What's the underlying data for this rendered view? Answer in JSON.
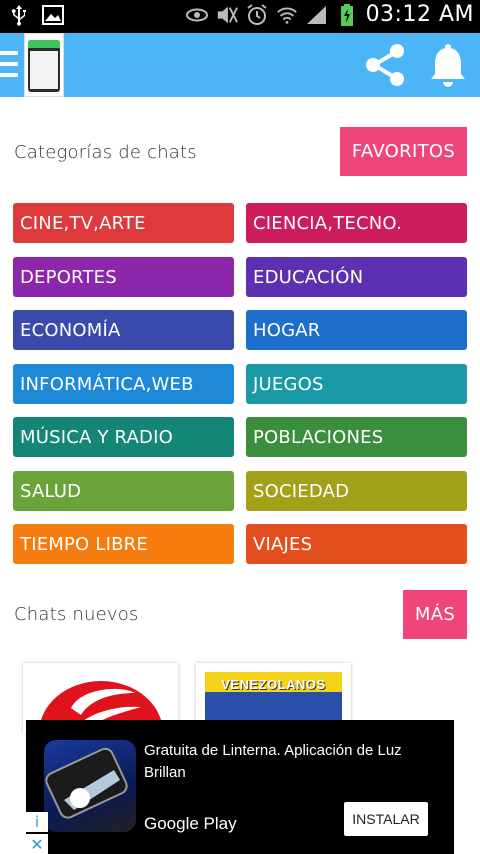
{
  "status_bar": {
    "time": "03:12 AM",
    "icons": [
      "usb-icon",
      "image-icon",
      "eye-icon",
      "mute-icon",
      "alarm-icon",
      "wifi-icon",
      "signal-icon",
      "battery-charging-icon"
    ]
  },
  "app_bar": {
    "background": "#4cb5f5",
    "icons": [
      "menu-icon",
      "app-logo",
      "share-icon",
      "notifications-bell-icon"
    ]
  },
  "categories_section": {
    "title": "Categorías de chats",
    "favorites_label": "FAVORITOS",
    "items": [
      {
        "label": "CINE,TV,ARTE",
        "color": "#de3a3c"
      },
      {
        "label": "CIENCIA,TECNO.",
        "color": "#cc1c5c"
      },
      {
        "label": "DEPORTES",
        "color": "#8c27ab"
      },
      {
        "label": "EDUCACIÓN",
        "color": "#5c30b0"
      },
      {
        "label": "ECONOMÍA",
        "color": "#3a4aaa"
      },
      {
        "label": "HOGAR",
        "color": "#1e6ecc"
      },
      {
        "label": "INFORMÁTICA,WEB",
        "color": "#1d89d8"
      },
      {
        "label": "JUEGOS",
        "color": "#1a9aa6"
      },
      {
        "label": "MÚSICA Y RADIO",
        "color": "#138677"
      },
      {
        "label": "POBLACIONES",
        "color": "#3a8e3e"
      },
      {
        "label": "SALUD",
        "color": "#6aa33a"
      },
      {
        "label": "SOCIEDAD",
        "color": "#a3a11a"
      },
      {
        "label": "TIEMPO LIBRE",
        "color": "#f77c10"
      },
      {
        "label": "VIAJES",
        "color": "#e34e1e"
      }
    ]
  },
  "new_chats_section": {
    "title": "Chats nuevos",
    "more_label": "MÁS",
    "cards": [
      {
        "name": "peru-chat-card"
      },
      {
        "name": "venezuela-chat-card",
        "banner_text": "VENEZOLANOS"
      }
    ]
  },
  "ad": {
    "text": "Gratuita de Linterna. Aplicación de Luz Brillan",
    "store": "Google Play",
    "install_label": "INSTALAR",
    "adchoices_info": "i",
    "adchoices_close": "✕"
  },
  "colors": {
    "accent_pink": "#f0457b",
    "app_bar_blue": "#4cb5f5"
  }
}
